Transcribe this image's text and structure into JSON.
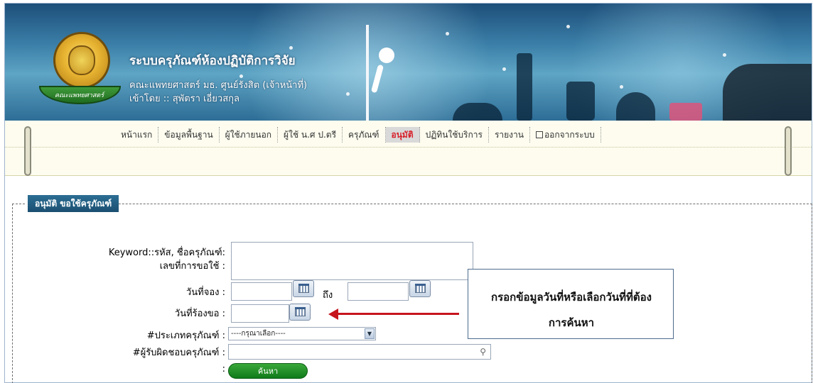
{
  "header": {
    "title": "ระบบครุภัณฑ์ห้องปฏิบัติการวิจัย",
    "subtitle": "คณะแพทยศาสตร์ มธ. ศูนย์รังสิต (เจ้าหน้าที่)",
    "user_line": "เข้าโดย :: สุพัตรา เอี่ยวสกุล",
    "logo_text": "คณะแพทยศาสตร์"
  },
  "nav": {
    "items": [
      {
        "label": "หน้าแรก",
        "active": false
      },
      {
        "label": "ข้อมูลพื้นฐาน",
        "active": false
      },
      {
        "label": "ผู้ใช้ภายนอก",
        "active": false
      },
      {
        "label": "ผู้ใช้ น.ศ ป.ตรี",
        "active": false
      },
      {
        "label": "ครุภัณฑ์",
        "active": false
      },
      {
        "label": "อนุมัติ",
        "active": true
      },
      {
        "label": "ปฏิทินใช้บริการ",
        "active": false
      },
      {
        "label": "รายงาน",
        "active": false
      },
      {
        "label": "ออกจากระบบ",
        "active": false
      }
    ],
    "accent_color": "#d8202a"
  },
  "panel": {
    "legend": "อนุมัติ ขอใช้ครุภัณฑ์"
  },
  "form": {
    "keyword_label_1": "Keyword::รหัส, ชื่อครุภัณฑ์:",
    "keyword_label_2": "เลขที่การขอใช้ :",
    "keyword_value": "",
    "booking_date_label": "วันที่จอง :",
    "booking_from": "",
    "to_label": "ถึง",
    "booking_to": "",
    "request_date_label": "วันที่ร้องขอ :",
    "request_date": "",
    "type_label": "#ประเภทครุภัณฑ์ :",
    "type_selected": "----กรุณาเลือก----",
    "owner_label": "#ผู้รับผิดชอบครุภัณฑ์ :",
    "owner_value": "",
    "search_colon": ":",
    "search_button": "ค้นหา"
  },
  "callout": {
    "line1": "กรอกข้อมูลวันที่หรือเลือกวันที่ที่ต้อง",
    "line2": "การค้นหา",
    "arrow_color": "#c6141c"
  },
  "icons": [
    "calendar-icon",
    "dropdown-arrow-icon",
    "search-icon",
    "logout-icon",
    "logo-emblem"
  ]
}
